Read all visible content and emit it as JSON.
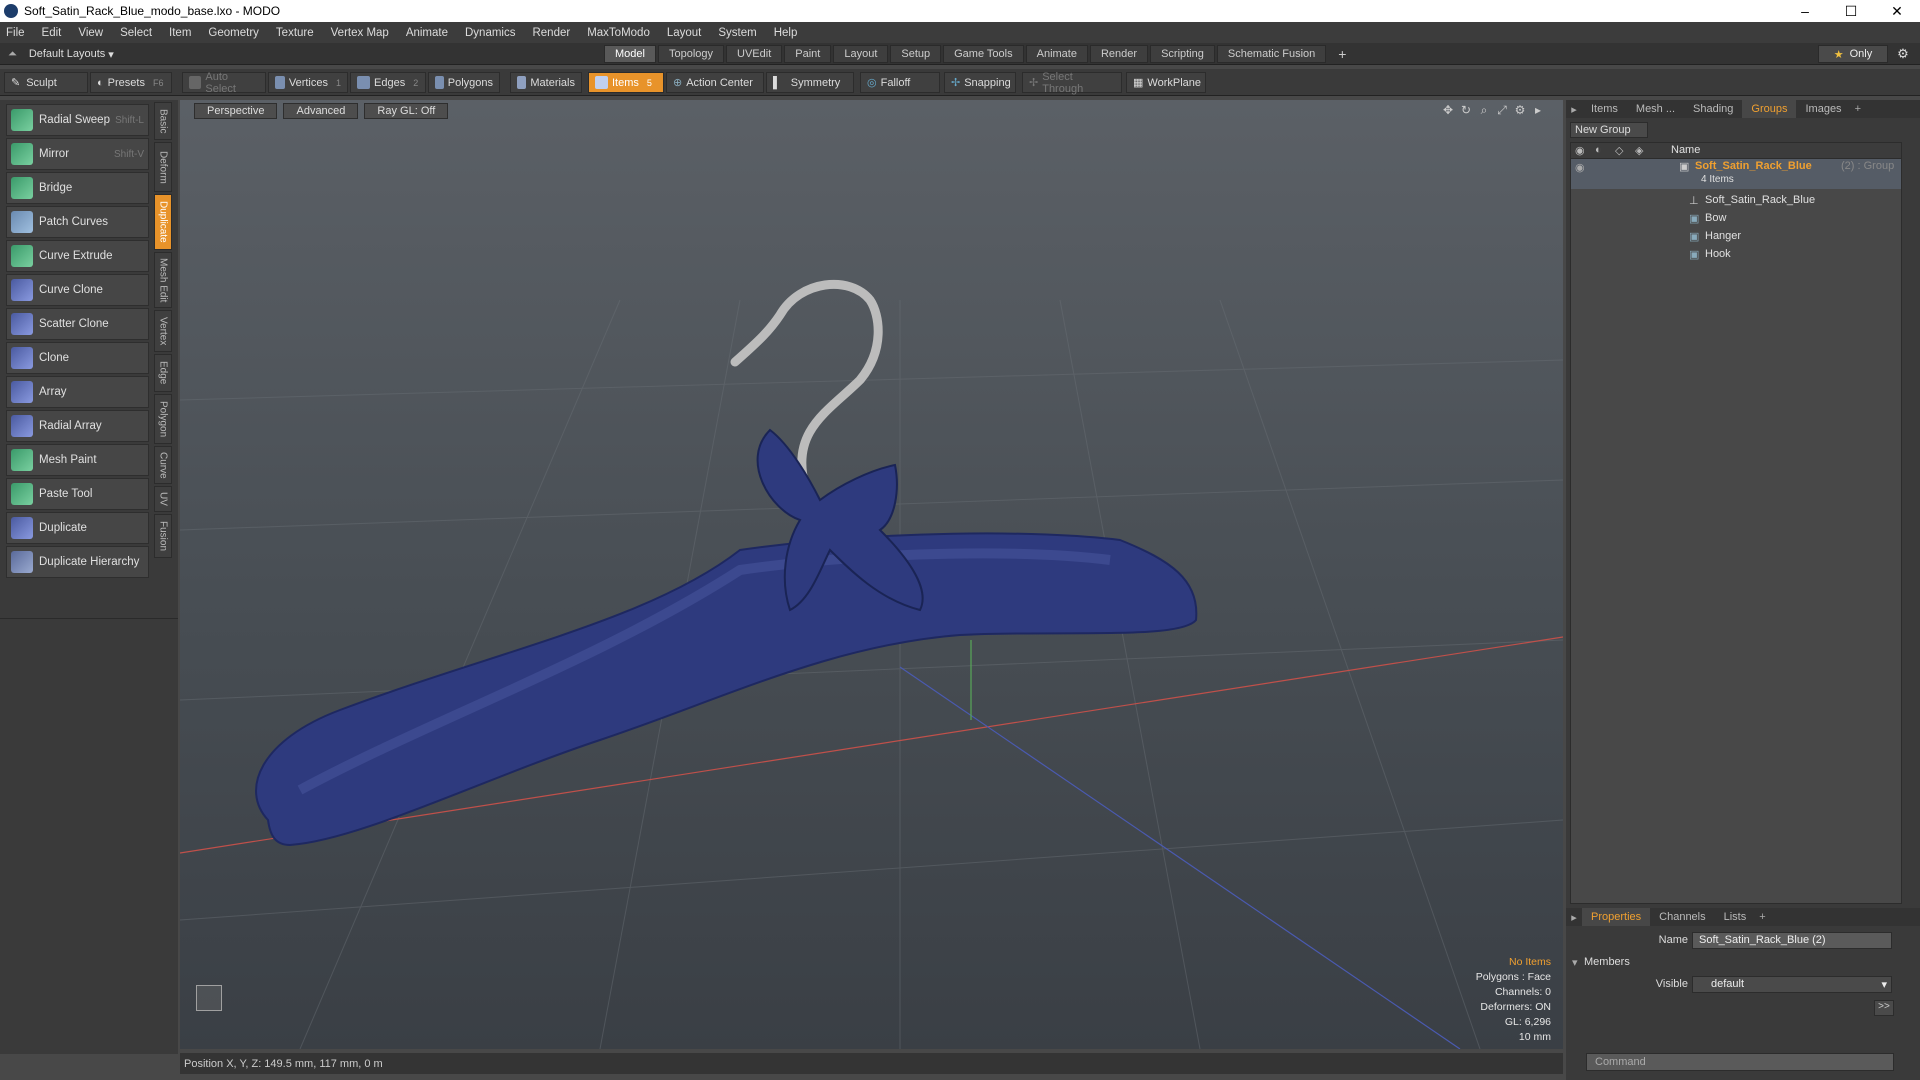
{
  "window": {
    "title": "Soft_Satin_Rack_Blue_modo_base.lxo - MODO"
  },
  "menu": [
    "File",
    "Edit",
    "View",
    "Select",
    "Item",
    "Geometry",
    "Texture",
    "Vertex Map",
    "Animate",
    "Dynamics",
    "Render",
    "MaxToModo",
    "Layout",
    "System",
    "Help"
  ],
  "layout_selector": "Default Layouts",
  "mode_tabs": [
    "Model",
    "Topology",
    "UVEdit",
    "Paint",
    "Layout",
    "Setup",
    "Game Tools",
    "Animate",
    "Render",
    "Scripting",
    "Schematic Fusion"
  ],
  "only_label": "Only",
  "toolbar": {
    "sculpt": "Sculpt",
    "presets": "Presets",
    "presets_key": "F6",
    "auto_select": "Auto Select",
    "vertices": "Vertices",
    "vertices_num": "1",
    "edges": "Edges",
    "edges_num": "2",
    "polygons": "Polygons",
    "materials": "Materials",
    "items": "Items",
    "items_num": "5",
    "action_center": "Action Center",
    "symmetry": "Symmetry",
    "falloff": "Falloff",
    "snapping": "Snapping",
    "select_through": "Select Through",
    "workplane": "WorkPlane"
  },
  "tools": [
    {
      "label": "Radial Sweep",
      "shortcut": "Shift-L"
    },
    {
      "label": "Mirror",
      "shortcut": "Shift-V"
    },
    {
      "label": "Bridge",
      "shortcut": ""
    },
    {
      "label": "Patch Curves",
      "shortcut": ""
    },
    {
      "label": "Curve Extrude",
      "shortcut": ""
    },
    {
      "label": "Curve Clone",
      "shortcut": ""
    },
    {
      "label": "Scatter Clone",
      "shortcut": ""
    },
    {
      "label": "Clone",
      "shortcut": ""
    },
    {
      "label": "Array",
      "shortcut": ""
    },
    {
      "label": "Radial Array",
      "shortcut": ""
    },
    {
      "label": "Mesh Paint",
      "shortcut": ""
    },
    {
      "label": "Paste Tool",
      "shortcut": ""
    },
    {
      "label": "Duplicate",
      "shortcut": ""
    },
    {
      "label": "Duplicate Hierarchy",
      "shortcut": ""
    }
  ],
  "vertical_tabs": [
    "Basic",
    "Deform",
    "Duplicate",
    "Mesh Edit",
    "Vertex",
    "Edge",
    "Polygon",
    "Curve",
    "UV",
    "Fusion"
  ],
  "viewport": {
    "tabs": [
      "Perspective",
      "Advanced",
      "Ray GL: Off"
    ],
    "stats": {
      "selection": "No Items",
      "polygons": "Polygons : Face",
      "channels": "Channels: 0",
      "deformers": "Deformers: ON",
      "gl": "GL: 6,296",
      "scale": "10 mm"
    }
  },
  "status": {
    "position": "Position X, Y, Z:   149.5 mm, 117 mm, 0 m"
  },
  "right_panel": {
    "tabs": [
      "Items",
      "Mesh ...",
      "Shading",
      "Groups",
      "Images"
    ],
    "new_group": "New Group",
    "name_header": "Name",
    "group": {
      "name": "Soft_Satin_Rack_Blue",
      "suffix": "(2) : Group",
      "count": "4 Items"
    },
    "children": [
      "Soft_Satin_Rack_Blue",
      "Bow",
      "Hanger",
      "Hook"
    ]
  },
  "properties": {
    "tabs": [
      "Properties",
      "Channels",
      "Lists"
    ],
    "name_label": "Name",
    "name_value": "Soft_Satin_Rack_Blue (2)",
    "members_label": "Members",
    "visible_label": "Visible",
    "visible_value": "default",
    "expand_btn": ">>",
    "command_placeholder": "Command"
  },
  "colors": {
    "accent": "#e8932a",
    "hanger_blue": "#2e3a7e",
    "viewport_top": "#5b6066"
  }
}
